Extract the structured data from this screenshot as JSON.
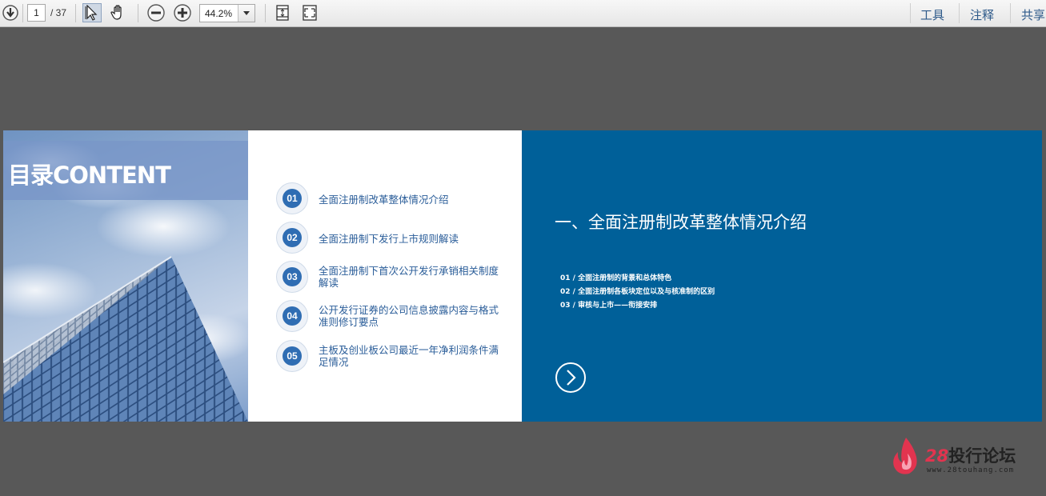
{
  "toolbar": {
    "page_current": "1",
    "page_total": "/ 37",
    "zoom_value": "44.2%",
    "menu": {
      "tools": "工具",
      "comment": "注释",
      "share": "共享"
    }
  },
  "icons": [
    "download-icon",
    "select-tool-icon",
    "hand-tool-icon",
    "zoom-out-icon",
    "zoom-in-icon",
    "fit-page-icon",
    "fit-width-icon",
    "dropdown-arrow-icon",
    "next-arrow-icon",
    "flame-logo-icon"
  ],
  "slide": {
    "title": "目录CONTENT",
    "toc": [
      {
        "num": "01",
        "label": "全面注册制改革整体情况介绍"
      },
      {
        "num": "02",
        "label": "全面注册制下发行上市规则解读"
      },
      {
        "num": "03",
        "label": "全面注册制下首次公开发行承销相关制度解读"
      },
      {
        "num": "04",
        "label": "公开发行证券的公司信息披露内容与格式准则修订要点"
      },
      {
        "num": "05",
        "label": "主板及创业板公司最近一年净利润条件满足情况"
      }
    ],
    "section_title": "一、全面注册制改革整体情况介绍",
    "sub_items": [
      "01 / 全面注册制的背景和总体特色",
      "02 / 全面注册制各板块定位以及与核准制的区别",
      "03 / 审核与上市——衔接安排"
    ]
  },
  "watermark": {
    "num": "28",
    "name": "投行论坛",
    "url": "www.28touhang.com"
  },
  "colors": {
    "panel_blue": "#006099",
    "toc_blue": "#2f6db3",
    "background": "#585858"
  }
}
